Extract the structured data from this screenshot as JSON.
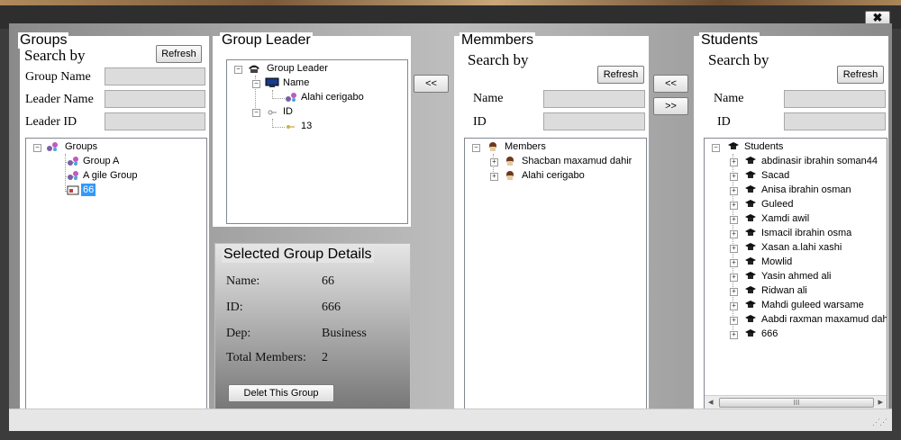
{
  "window": {
    "close_label": "✖"
  },
  "groups": {
    "title": "Groups",
    "search_by": "Search by",
    "refresh": "Refresh",
    "fields": [
      {
        "label": "Group Name",
        "value": ""
      },
      {
        "label": "Leader Name",
        "value": ""
      },
      {
        "label": "Leader ID",
        "value": ""
      }
    ],
    "tree": {
      "root": "Groups",
      "items": [
        "Group A",
        "A gile Group",
        "66"
      ],
      "selected": "66"
    }
  },
  "leader": {
    "title": "Group Leader",
    "tree": {
      "root": "Group Leader",
      "name_node": "Name",
      "name_value": "Alahi cerigabo",
      "id_node": "ID",
      "id_value": "13"
    }
  },
  "details": {
    "title": "Selected Group Details",
    "rows": [
      {
        "label": "Name:",
        "value": "66"
      },
      {
        "label": "ID:",
        "value": "666"
      },
      {
        "label": "Dep:",
        "value": "Business"
      },
      {
        "label": "Total Members:",
        "value": "2"
      }
    ],
    "delete_button": "Delet This Group"
  },
  "arrows": {
    "leader_add": "<<",
    "member_add": "<<",
    "member_remove": ">>"
  },
  "members": {
    "title": "Memmbers",
    "search_by": "Search by",
    "refresh": "Refresh",
    "fields": [
      {
        "label": "Name",
        "value": ""
      },
      {
        "label": "ID",
        "value": ""
      }
    ],
    "tree": {
      "root": "Members",
      "items": [
        "Shacban maxamud dahir",
        "Alahi cerigabo"
      ]
    }
  },
  "students": {
    "title": "Students",
    "search_by": "Search by",
    "refresh": "Refresh",
    "fields": [
      {
        "label": "Name",
        "value": ""
      },
      {
        "label": "ID",
        "value": ""
      }
    ],
    "tree": {
      "root": "Students",
      "items": [
        "abdinasir ibrahin soman44",
        "Sacad",
        "Anisa ibrahin osman",
        "Guleed",
        "Xamdi awil",
        "Ismacil ibrahin osma",
        "Xasan a.lahi xashi",
        "Mowlid",
        "Yasin ahmed ali",
        "Ridwan ali",
        "Mahdi guleed warsame",
        "Aabdi raxman maxamud dahir",
        "666"
      ]
    },
    "scroll": {
      "left": "◂",
      "right": "▸",
      "grip": "III"
    }
  },
  "colors": {
    "selection": "#3399ff",
    "window_bg": "#3c3c3c"
  }
}
